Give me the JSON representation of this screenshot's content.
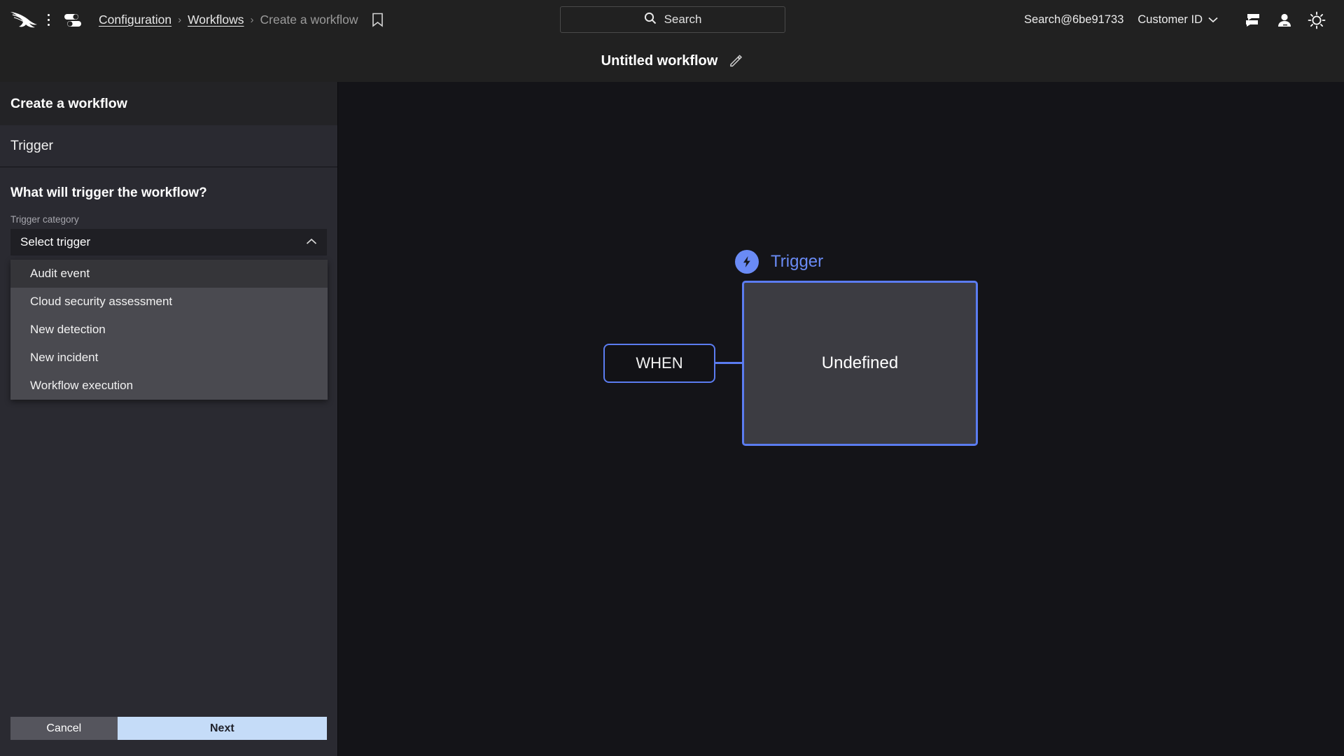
{
  "topbar": {
    "logo_icon": "crowdstrike-falcon-logo",
    "kebab_icon": "kebab-menu-icon",
    "grid_toggle_icon": "app-switcher-icon",
    "breadcrumb": {
      "items": [
        {
          "label": "Configuration",
          "type": "link"
        },
        {
          "label": "Workflows",
          "type": "link"
        },
        {
          "label": "Create a workflow",
          "type": "current"
        }
      ],
      "separator": "›"
    },
    "bookmark_icon": "bookmark-icon",
    "search": {
      "placeholder": "Search",
      "value": "",
      "icon": "search-icon"
    },
    "tenant_id": "Search@6be91733",
    "customer_id_label": "Customer ID",
    "customer_id_caret": "chevron-down-icon",
    "icons": [
      "chat-icon",
      "user-icon",
      "theme-brightness-icon"
    ]
  },
  "subheader": {
    "workflow_title": "Untitled workflow",
    "edit_icon": "pencil-edit-icon"
  },
  "sidebar": {
    "panel_title": "Create a workflow",
    "step_name": "Trigger",
    "question": "What will trigger the workflow?",
    "field_label": "Trigger category",
    "select": {
      "value": "Select trigger",
      "placeholder": "Select trigger",
      "expanded": true,
      "caret_icon": "chevron-up-icon",
      "options": [
        {
          "label": "Audit event",
          "highlighted": true
        },
        {
          "label": "Cloud security assessment",
          "highlighted": false
        },
        {
          "label": "New detection",
          "highlighted": false
        },
        {
          "label": "New incident",
          "highlighted": false
        },
        {
          "label": "Workflow execution",
          "highlighted": false
        }
      ]
    },
    "cancel_label": "Cancel",
    "next_label": "Next"
  },
  "canvas": {
    "trigger_label": "Trigger",
    "trigger_badge_icon": "lightning-bolt-icon",
    "when_node_label": "WHEN",
    "undefined_node_label": "Undefined"
  },
  "colors": {
    "accent_blue": "#5b7cf0",
    "trigger_blue": "#6a8bf5",
    "next_button": "#c5dcf8",
    "cancel_button": "#55555d",
    "sidebar_bg": "#2a2a31",
    "canvas_bg": "#141418",
    "topbar_bg": "#212121"
  }
}
